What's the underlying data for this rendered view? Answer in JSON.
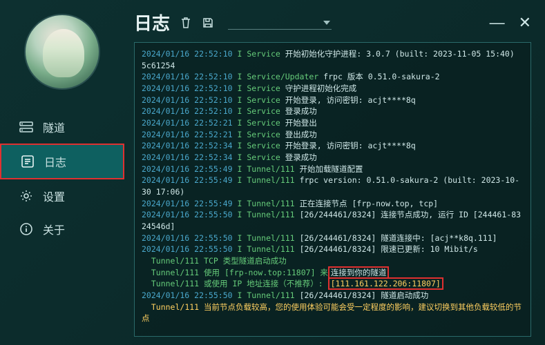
{
  "window": {
    "minimize": "—",
    "close": "✕"
  },
  "sidebar": {
    "items": [
      {
        "label": "隧道"
      },
      {
        "label": "日志"
      },
      {
        "label": "设置"
      },
      {
        "label": "关于"
      }
    ]
  },
  "header": {
    "title": "日志"
  },
  "log": {
    "lines": [
      {
        "ts": "2024/01/16 22:52:10",
        "lvl": "I",
        "src": "Service",
        "msg": "开始初始化守护进程: 3.0.7 (built: 2023-11-05 15:40) 5c61254"
      },
      {
        "ts": "2024/01/16 22:52:10",
        "lvl": "I",
        "src": "Service/Updater",
        "msg": "frpc 版本 0.51.0-sakura-2"
      },
      {
        "ts": "2024/01/16 22:52:10",
        "lvl": "I",
        "src": "Service",
        "msg": "守护进程初始化完成"
      },
      {
        "ts": "2024/01/16 22:52:10",
        "lvl": "I",
        "src": "Service",
        "msg": "开始登录, 访问密钥: acjt****8q"
      },
      {
        "ts": "2024/01/16 22:52:10",
        "lvl": "I",
        "src": "Service",
        "msg": "登录成功"
      },
      {
        "ts": "2024/01/16 22:52:21",
        "lvl": "I",
        "src": "Service",
        "msg": "开始登出"
      },
      {
        "ts": "2024/01/16 22:52:21",
        "lvl": "I",
        "src": "Service",
        "msg": "登出成功"
      },
      {
        "ts": "2024/01/16 22:52:34",
        "lvl": "I",
        "src": "Service",
        "msg": "开始登录, 访问密钥: acjt****8q"
      },
      {
        "ts": "2024/01/16 22:52:34",
        "lvl": "I",
        "src": "Service",
        "msg": "登录成功"
      },
      {
        "ts": "2024/01/16 22:55:49",
        "lvl": "I",
        "src": "Tunnel/111",
        "msg": "开始加载隧道配置"
      },
      {
        "ts": "2024/01/16 22:55:49",
        "lvl": "I",
        "src": "Tunnel/111",
        "msg": "frpc version: 0.51.0-sakura-2 (built: 2023-10-30 17:06)"
      },
      {
        "ts": "2024/01/16 22:55:49",
        "lvl": "I",
        "src": "Tunnel/111",
        "msg": "正在连接节点 [frp-now.top, tcp]"
      },
      {
        "ts": "2024/01/16 22:55:50",
        "lvl": "I",
        "src": "Tunnel/111",
        "msg": "[26/244461/8324] 连接节点成功, 运行 ID [244461-8324546d]"
      },
      {
        "ts": "2024/01/16 22:55:50",
        "lvl": "I",
        "src": "Tunnel/111",
        "msg": "[26/244461/8324] 隧道连接中: [acj**k8q.111]"
      },
      {
        "ts": "2024/01/16 22:55:50",
        "lvl": "I",
        "src": "Tunnel/111",
        "msg": "[26/244461/8324] 限速已更新: 10 Mibit/s"
      }
    ],
    "tail": {
      "a": "Tunnel/111 TCP 类型隧道启动成功",
      "b_pre": "Tunnel/111 使用 [frp-now.top:11807] 来",
      "b_box": "连接到你的隧道",
      "c_pre": "Tunnel/111 或使用 IP 地址连接（不推荐）:",
      "c_box": "[111.161.122.206:11807]",
      "d_ts": "2024/01/16 22:55:50",
      "d_lvl": "I",
      "d_src": "Tunnel/111",
      "d_msg": "[26/244461/8324] 隧道启动成功",
      "e": "Tunnel/111 当前节点负载较高，您的使用体验可能会受一定程度的影响，建议切换到其他负载较低的节点"
    }
  }
}
